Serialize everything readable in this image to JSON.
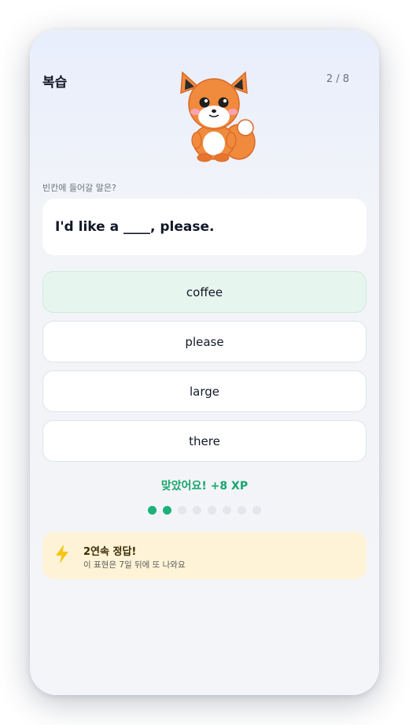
{
  "header": {
    "title": "복습",
    "progress_text": "2 / 8"
  },
  "mascot": {
    "icon": "fox-mascot-icon"
  },
  "question": {
    "prompt": "빈칸에 들어갈 말은?",
    "sentence": "I'd like a ____, please."
  },
  "options": [
    {
      "label": "coffee",
      "state": "correct"
    },
    {
      "label": "please",
      "state": "default"
    },
    {
      "label": "large",
      "state": "default"
    },
    {
      "label": "there",
      "state": "default"
    }
  ],
  "feedback": {
    "text": "맞았어요! +8 XP",
    "color": "#1aa56d"
  },
  "progress": {
    "current": 2,
    "total": 8
  },
  "streak": {
    "icon": "lightning-icon",
    "title": "2연속 정답!",
    "subtitle": "이 표현은 7일 뒤에 또 나와요"
  },
  "colors": {
    "accent": "#1bb27a",
    "correct_bg": "#e6f6ef",
    "streak_bg": "#fef3d7",
    "bolt": "#f5c518"
  }
}
